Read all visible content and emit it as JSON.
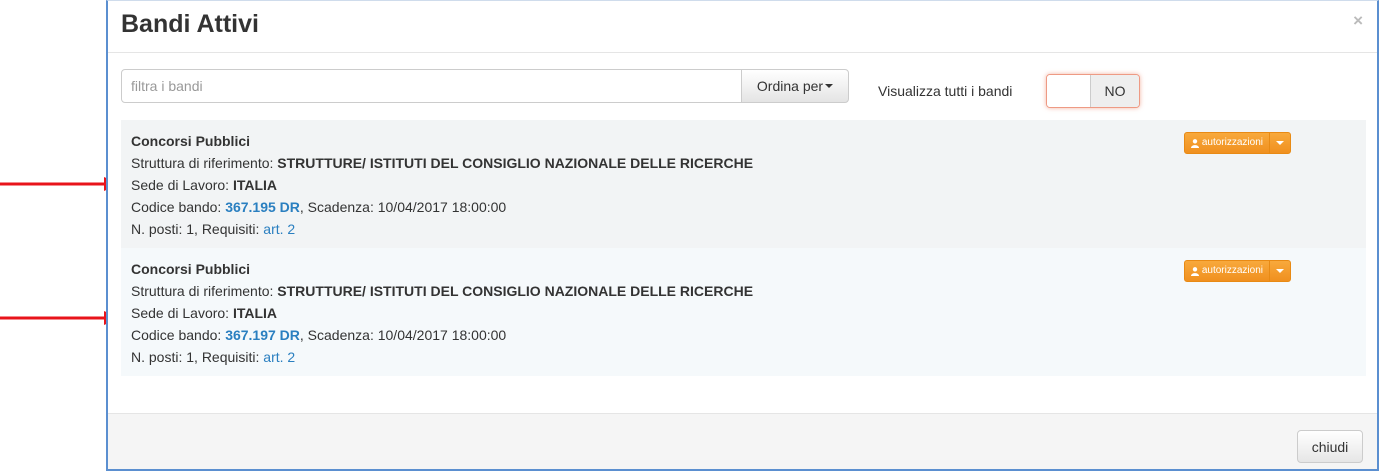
{
  "modal": {
    "title": "Bandi Attivi",
    "close_glyph": "×",
    "icon_close": "close-icon"
  },
  "filters": {
    "search_placeholder": "filtra i bandi",
    "search_value": "",
    "sort_label": "Ordina per",
    "show_all_label": "Visualizza tutti i bandi",
    "toggle_value": "NO"
  },
  "bandi": [
    {
      "category": "Concorsi Pubblici",
      "structure_label": "Struttura di riferimento:",
      "structure_value": "STRUTTURE/ ISTITUTI DEL CONSIGLIO NAZIONALE DELLE RICERCHE",
      "location_label": "Sede di Lavoro:",
      "location_value": "ITALIA",
      "code_label": "Codice bando:",
      "code_value": "367.195 DR",
      "deadline_label": ", Scadenza:",
      "deadline_value": "10/04/2017 18:00:00",
      "posts_label": "N. posti:",
      "posts_value": "1",
      "requirements_label": ", Requisiti:",
      "requirements_value": "art. 2",
      "action_label": "autorizzazioni"
    },
    {
      "category": "Concorsi Pubblici",
      "structure_label": "Struttura di riferimento:",
      "structure_value": "STRUTTURE/ ISTITUTI DEL CONSIGLIO NAZIONALE DELLE RICERCHE",
      "location_label": "Sede di Lavoro:",
      "location_value": "ITALIA",
      "code_label": "Codice bando:",
      "code_value": "367.197 DR",
      "deadline_label": ", Scadenza:",
      "deadline_value": "10/04/2017 18:00:00",
      "posts_label": "N. posti:",
      "posts_value": "1",
      "requirements_label": ", Requisiti:",
      "requirements_value": "art. 2",
      "action_label": "autorizzazioni"
    }
  ],
  "footer": {
    "close_label": "chiudi"
  },
  "colors": {
    "link": "#2a7fc0",
    "action_orange": "#f0901f",
    "annotation_arrow": "#e8141b",
    "modal_border": "#5b8fd0"
  }
}
